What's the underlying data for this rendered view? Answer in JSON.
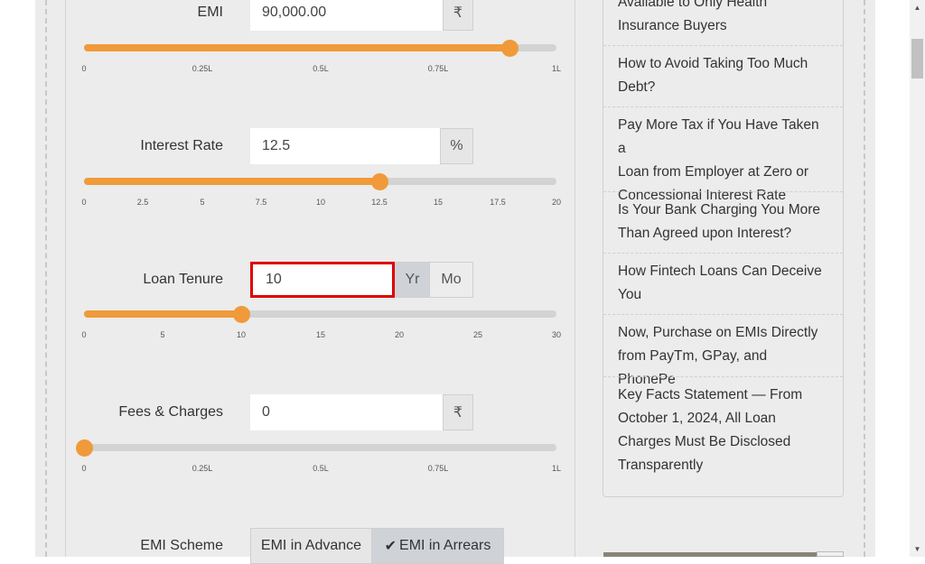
{
  "emi": {
    "label": "EMI",
    "value": "90,000.00",
    "unit": "₹",
    "slider_level": 0.9,
    "ticks": [
      "0",
      "0.25L",
      "0.5L",
      "0.75L",
      "1L"
    ]
  },
  "interest": {
    "label": "Interest Rate",
    "value": "12.5",
    "unit": "%",
    "slider_level": 0.625,
    "ticks": [
      "0",
      "2.5",
      "5",
      "7.5",
      "10",
      "12.5",
      "15",
      "17.5",
      "20"
    ]
  },
  "tenure": {
    "label": "Loan Tenure",
    "value": "10",
    "unit_year": "Yr",
    "unit_month": "Mo",
    "selected_unit": "Yr",
    "slider_level": 0.3333,
    "ticks": [
      "0",
      "5",
      "10",
      "15",
      "20",
      "25",
      "30"
    ]
  },
  "fees": {
    "label": "Fees & Charges",
    "value": "0",
    "unit": "₹",
    "slider_level": 0,
    "ticks": [
      "0",
      "0.25L",
      "0.5L",
      "0.75L",
      "1L"
    ]
  },
  "scheme": {
    "label": "EMI Scheme",
    "options": [
      "EMI in Advance",
      "EMI in Arrears"
    ],
    "selected": "EMI in Arrears",
    "check_glyph": "✔"
  },
  "sidebar": {
    "articles": [
      {
        "lines": [
          "Available to Only Health",
          "Insurance Buyers"
        ]
      },
      {
        "lines": [
          "How to Avoid Taking Too Much",
          "Debt?"
        ]
      },
      {
        "lines": [
          "Pay More Tax if You Have Taken a",
          "Loan from Employer at Zero or",
          "Concessional Interest Rate"
        ]
      },
      {
        "lines": [
          "Is Your Bank Charging You More",
          "Than Agreed upon Interest?"
        ]
      },
      {
        "lines": [
          "How Fintech Loans Can Deceive",
          "You"
        ]
      },
      {
        "lines": [
          "Now, Purchase on EMIs Directly",
          "from PayTm, GPay, and PhonePe"
        ]
      },
      {
        "lines": [
          "Key Facts Statement — From",
          "October 1, 2024, All Loan",
          "Charges Must Be Disclosed",
          "Transparently"
        ]
      }
    ]
  },
  "colors": {
    "accent": "#f09a3a",
    "focus_border": "#e00000",
    "track": "#d3d3d3"
  }
}
